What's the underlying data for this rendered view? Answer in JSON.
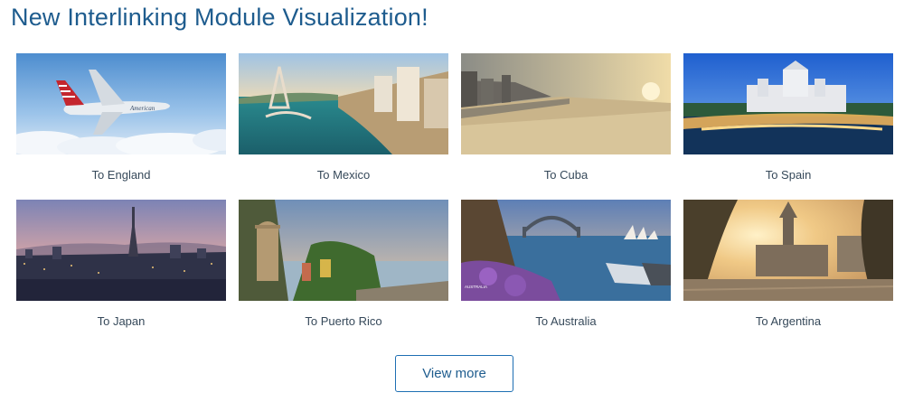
{
  "heading": "New Interlinking Module Visualization!",
  "destinations": [
    {
      "label": "To England"
    },
    {
      "label": "To Mexico"
    },
    {
      "label": "To Cuba"
    },
    {
      "label": "To Spain"
    },
    {
      "label": "To Japan"
    },
    {
      "label": "To Puerto Rico"
    },
    {
      "label": "To Australia"
    },
    {
      "label": "To Argentina"
    }
  ],
  "plane_livery_text": "American",
  "photo_watermark": "AUSTRALIA",
  "view_more_label": "View more"
}
